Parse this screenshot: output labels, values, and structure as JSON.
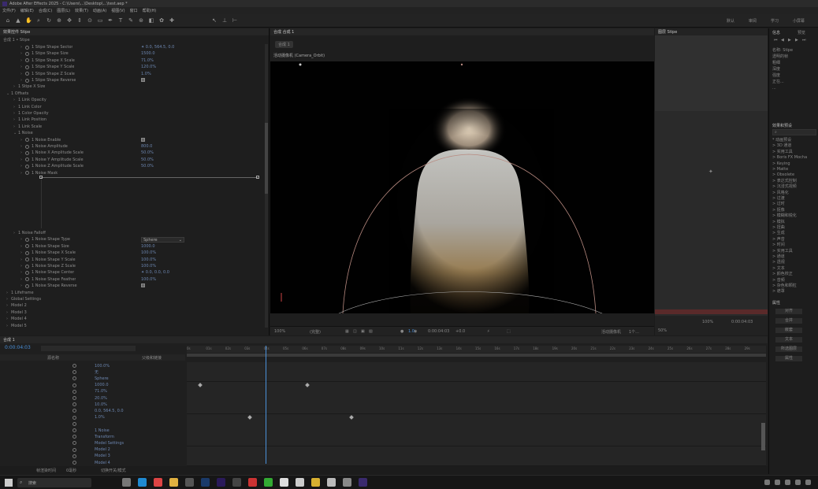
{
  "window": {
    "title": "Adobe After Effects 2025 - C:\\Users\\...\\Desktop\\...\\test.aep *",
    "menu": [
      "文件(F)",
      "编辑(E)",
      "合成(C)",
      "图层(L)",
      "效果(T)",
      "动画(A)",
      "视图(V)",
      "窗口",
      "帮助(H)"
    ]
  },
  "workspace_tabs": [
    "默认",
    "审阅",
    "学习",
    "小屏幕"
  ],
  "effects_panel": {
    "tab_label": "效果控件 Stipe",
    "breadcrumb": "合成 1 • Stipe",
    "rows": [
      {
        "indent": 2,
        "label": "1 Stipe Shape Sector",
        "value": "✦ 0.0,  564.5, 0.0",
        "type": "value"
      },
      {
        "indent": 2,
        "label": "1 Stipe Shape Size",
        "value": "1500.0",
        "type": "value"
      },
      {
        "indent": 2,
        "label": "1 Stipe Shape X Scale",
        "value": "71.0%",
        "type": "value"
      },
      {
        "indent": 2,
        "label": "1 Stipe Shape Y Scale",
        "value": "120.0%",
        "type": "value"
      },
      {
        "indent": 2,
        "label": "1 Stipe Shape Z Scale",
        "value": "1.0%",
        "type": "value"
      },
      {
        "indent": 2,
        "label": "1 Stipe Shape Reverse",
        "value": "",
        "type": "check"
      },
      {
        "indent": 1,
        "label": "1 Stipe X Size",
        "value": "",
        "type": "group"
      },
      {
        "indent": 0,
        "label": "1 Offsets",
        "value": "",
        "type": "open"
      },
      {
        "indent": 1,
        "label": "1 Link Opacity",
        "value": "",
        "type": "group"
      },
      {
        "indent": 1,
        "label": "1 Link Color",
        "value": "",
        "type": "group"
      },
      {
        "indent": 1,
        "label": "1 Color Opacity",
        "value": "",
        "type": "group"
      },
      {
        "indent": 1,
        "label": "1 Link Position",
        "value": "",
        "type": "group"
      },
      {
        "indent": 1,
        "label": "1 Link Scale",
        "value": "",
        "type": "group"
      },
      {
        "indent": 1,
        "label": "1 Noise",
        "value": "",
        "type": "open"
      },
      {
        "indent": 2,
        "label": "1 Noise Enable",
        "value": "",
        "type": "check"
      },
      {
        "indent": 2,
        "label": "1 Noise Amplitude",
        "value": "800.0",
        "type": "value"
      },
      {
        "indent": 2,
        "label": "1 Noise X Amplitude Scale",
        "value": "50.0%",
        "type": "value"
      },
      {
        "indent": 2,
        "label": "1 Noise Y Amplitude Scale",
        "value": "50.0%",
        "type": "value"
      },
      {
        "indent": 2,
        "label": "1 Noise Z Amplitude Scale",
        "value": "50.0%",
        "type": "value"
      },
      {
        "indent": 2,
        "label": "1 Noise Mask",
        "value": "",
        "type": "graph"
      }
    ],
    "rows_lower": [
      {
        "indent": 1,
        "label": "1 Noise Falloff",
        "value": "",
        "type": "group"
      },
      {
        "indent": 2,
        "label": "1 Noise Shape Type",
        "value": "Sphere",
        "type": "select"
      },
      {
        "indent": 2,
        "label": "1 Noise Shape Size",
        "value": "1000.0",
        "type": "value"
      },
      {
        "indent": 2,
        "label": "1 Noise Shape X Scale",
        "value": "100.0%",
        "type": "value"
      },
      {
        "indent": 2,
        "label": "1 Noise Shape Y Scale",
        "value": "100.0%",
        "type": "value"
      },
      {
        "indent": 2,
        "label": "1 Noise Shape Z Scale",
        "value": "100.0%",
        "type": "value"
      },
      {
        "indent": 2,
        "label": "1 Noise Shape Center",
        "value": "✦ 0.0, 0.0, 0.0",
        "type": "value"
      },
      {
        "indent": 2,
        "label": "1 Noise Shape Feather",
        "value": "100.0%",
        "type": "value"
      },
      {
        "indent": 2,
        "label": "1 Noise Shape Reverse",
        "value": "",
        "type": "check"
      },
      {
        "indent": 0,
        "label": "1 Lifeframe",
        "value": "",
        "type": "group"
      },
      {
        "indent": 0,
        "label": "Global Settings",
        "value": "",
        "type": "group"
      },
      {
        "indent": 0,
        "label": "Model 2",
        "value": "",
        "type": "group"
      },
      {
        "indent": 0,
        "label": "Model 3",
        "value": "",
        "type": "group"
      },
      {
        "indent": 0,
        "label": "Model 4",
        "value": "",
        "type": "group"
      },
      {
        "indent": 0,
        "label": "Model 5",
        "value": "",
        "type": "group"
      }
    ]
  },
  "viewer": {
    "tab_label": "合成 合成 1",
    "sub_tab": "合成 1",
    "camera_label": "活动摄像机 (Camera_Orbit)",
    "bottom": [
      "100%",
      "(完整)",
      "0:00:04:03",
      "+0.0",
      "活动摄像机",
      "1个..."
    ],
    "mini": "1.0"
  },
  "layer_view": {
    "tab_label": "图层 Stipe",
    "bottom": [
      "50%",
      "0:00:04:03"
    ],
    "zoom": "100%"
  },
  "right_panel": {
    "title": "信息",
    "sub": "预览",
    "section": "效果和预设",
    "search": "",
    "list_top": [
      "名称: Stipe",
      "透明的帧",
      "粗细",
      "深度",
      "强度",
      "正在...",
      "..."
    ],
    "tree": [
      "* 动画预设",
      "> 3D 通道",
      "> 实用工具",
      "> Boris FX Mocha",
      "> Keying",
      "> Matte",
      "> Obsolete",
      "> 表达式控制",
      "> 沉浸式视频",
      "> 风格化",
      "> 过渡",
      "> 过时",
      "> 抠像",
      "> 模糊和锐化",
      "> 模拟",
      "> 扭曲",
      "> 生成",
      "> 声音",
      "> 时间",
      "> 实用工具",
      "> 通道",
      "> 透视",
      "> 文本",
      "> 颜色校正",
      "> 音频",
      "> 杂色和颗粒",
      "> 遮罩"
    ],
    "lower_title": "属性",
    "lower_items": [
      "对齐",
      "合并",
      "嵌套",
      "文本",
      "所选图层",
      "属性"
    ]
  },
  "timeline": {
    "tab_label": "合成 1",
    "timecode": "0:00:04:03",
    "search_placeholder": "",
    "headers": [
      "源名称",
      "父级和链接"
    ],
    "ruler": [
      "0s",
      "01s",
      "02s",
      "03s",
      "04s",
      "05s",
      "06s",
      "07s",
      "08s",
      "09s",
      "10s",
      "11s",
      "12s",
      "13s",
      "14s",
      "15s",
      "16s",
      "17s",
      "18s",
      "19s",
      "20s",
      "21s",
      "22s",
      "23s",
      "24s",
      "25s",
      "26s",
      "27s",
      "28s",
      "29s"
    ],
    "rows": [
      {
        "label": "100.0%",
        "kf": []
      },
      {
        "label": "无",
        "kf": []
      },
      {
        "label": "Sphere",
        "kf": []
      },
      {
        "label": "1000.0",
        "kf": [
          0.6,
          6.2
        ]
      },
      {
        "label": "71.0%",
        "kf": []
      },
      {
        "label": "20.0%",
        "kf": []
      },
      {
        "label": "10.0%",
        "kf": []
      },
      {
        "label": "0.0, 564.5, 0.0",
        "kf": []
      },
      {
        "label": "1.0%",
        "kf": [
          3.2,
          8.5
        ]
      },
      {
        "label": "",
        "kf": []
      },
      {
        "label": "1 Noise",
        "kf": []
      },
      {
        "label": "Transform",
        "kf": []
      },
      {
        "label": "Model Settings",
        "kf": []
      },
      {
        "label": "Model 2",
        "kf": []
      },
      {
        "label": "Model 3",
        "kf": []
      },
      {
        "label": "Model 4",
        "kf": []
      }
    ],
    "footer": [
      "帧渲染时间",
      "0毫秒",
      "切换开关/模式"
    ]
  },
  "taskbar": {
    "search": "搜索",
    "time": "",
    "date": ""
  },
  "colors": {
    "accent_blue": "#2d8cff",
    "playhead": "#4a90d9",
    "keyframe": "#aaaaaa"
  }
}
